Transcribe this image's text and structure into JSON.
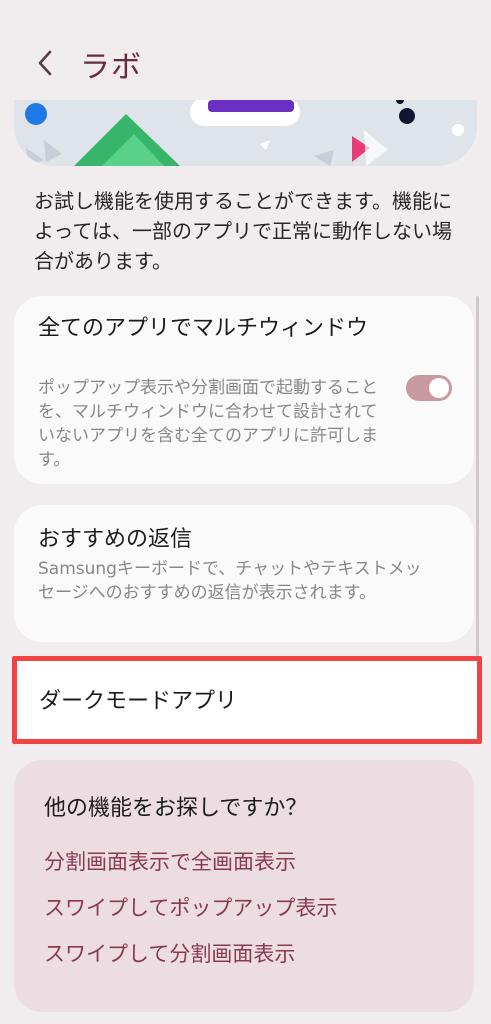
{
  "header": {
    "title": "ラボ",
    "back_icon": "chevron-left-icon"
  },
  "banner": {
    "illustration": "lab-illustration"
  },
  "intro": {
    "text": "お試し機能を使用することができます。機能によっては、一部のアプリで正常に動作しない場合があります。"
  },
  "multi_window": {
    "title": "全てのアプリでマルチウィンドウ",
    "description": "ポップアップ表示や分割画面で起動することを、マルチウィンドウに合わせて設計されていないアプリを含む全てのアプリに許可します。",
    "toggle_on": true
  },
  "suggested_replies": {
    "title": "おすすめの返信",
    "description": "Samsungキーボードで、チャットやテキストメッセージへのおすすめの返信が表示されます。"
  },
  "dark_mode_apps": {
    "label": "ダークモードアプリ"
  },
  "more_features": {
    "title": "他の機能をお探しですか？",
    "links": [
      "分割画面表示で全画面表示",
      "スワイプしてポップアップ表示",
      "スワイプして分割画面表示"
    ]
  },
  "colors": {
    "accent": "#8a3a4f",
    "highlight_border": "#f04444",
    "toggle": "#c99aa2"
  }
}
